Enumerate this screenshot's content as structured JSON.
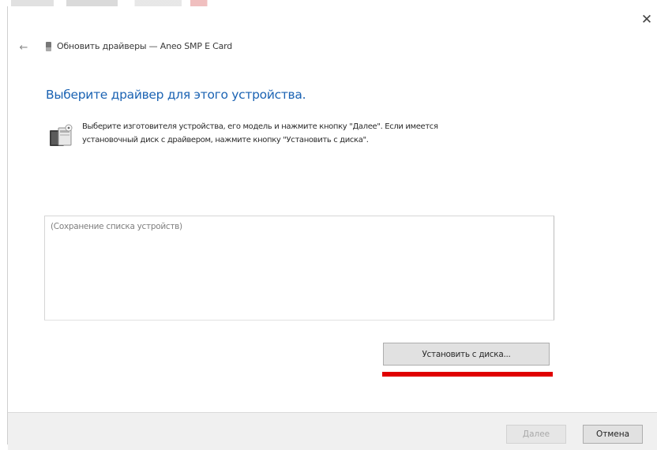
{
  "window": {
    "close_glyph": "✕",
    "back_glyph": "←",
    "title": "Обновить драйверы — Aneo SMP E Card"
  },
  "main": {
    "heading": "Выберите драйвер для этого устройства.",
    "info_lines": [
      "Выберите изготовителя устройства, его модель и нажмите кнопку \"Далее\". Если имеется",
      "установочный диск с драйвером, нажмите кнопку \"Установить с диска\"."
    ],
    "list_placeholder": "(Сохранение списка устройств)",
    "have_disk_label": "Установить с диска...",
    "highlight_color": "#e00000"
  },
  "footer": {
    "next_label": "Далее",
    "cancel_label": "Отмена"
  },
  "icons": {
    "back": "back-arrow-icon",
    "device": "device-icon",
    "info": "hardware-device-icon",
    "close": "close-icon"
  }
}
